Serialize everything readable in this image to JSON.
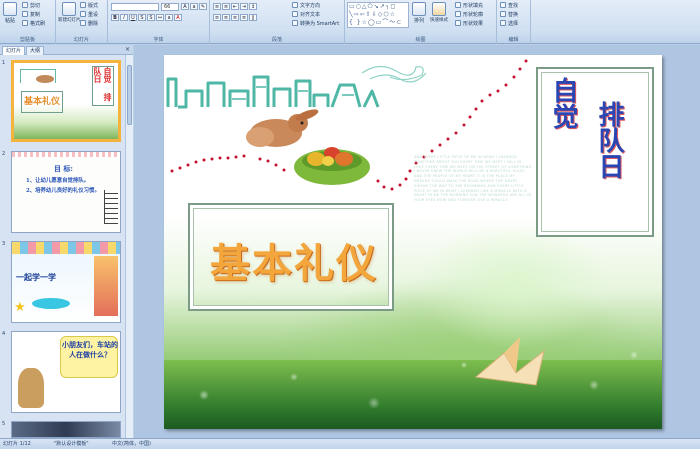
{
  "ribbon": {
    "clipboard": {
      "paste": "粘贴",
      "cut": "剪切",
      "copy": "复制",
      "format_painter": "格式刷",
      "label": "剪贴板"
    },
    "slides": {
      "new_slide": "新建幻灯片",
      "layout": "版式",
      "reset": "重设",
      "delete": "删除",
      "label": "幻灯片"
    },
    "font": {
      "font_size": "66",
      "label": "字体"
    },
    "paragraph": {
      "text_direction": "文字方向",
      "align_text": "对齐文本",
      "smartart": "转换为 SmartArt",
      "label": "段落"
    },
    "drawing": {
      "arrange": "排列",
      "quick_styles": "快速样式",
      "shape_fill": "形状填充",
      "shape_outline": "形状轮廓",
      "shape_effects": "形状效果",
      "label": "绘图"
    },
    "editing": {
      "find": "查找",
      "replace": "替换",
      "select": "选择",
      "label": "编辑"
    }
  },
  "panel": {
    "tab_slides": "幻灯片",
    "tab_outline": "大纲",
    "thumbs": [
      {
        "num": "1",
        "title": "基本礼仪",
        "side": "自觉 排队日"
      },
      {
        "num": "2",
        "head": "目 标:",
        "line1": "1、让幼儿愿意自觉排队。",
        "line2": "2、培养幼儿良好的礼仪习惯。"
      },
      {
        "num": "3",
        "text": "一起学一学"
      },
      {
        "num": "4",
        "text": "小朋友们，车站的人在做什么？"
      },
      {
        "num": "5"
      }
    ]
  },
  "slide": {
    "title": "基本礼仪",
    "vertical_1": "自觉",
    "vertical_2": "排队日",
    "english_text": "AND EVERY LITTLE PIECE OF ME IN WHAT I LEARNED TOGETHER ABOUT YOU EVERY TIME WE MEET I FALL IN LOVE EVERY TIME WE MEET ON THE STREET OF SOMETHING I NEVER KNEW THE WORLD WILL BE A BEAUTIFUL PLACE AND THE PEOPLE OF MY HEART IT IS THE PLACE MY DREAMS COULD WALK THE ROAD WHERE THE HEART SHOWS THE WAY TO THE BEGINNING AND EVERY LITTLE PIECE OF ME IN WHAT I LEARNED LIKE A MIRACLE WITH A HEART IN ME THE MORNING SUN THE WONDERS ARE ALL IN YOUR EYES NOW AND FOREVER LIKE A MIRACLE"
  },
  "status": {
    "slide_info": "幻灯片 1/12",
    "theme": "\"默认设计模板\"",
    "language": "中文(简体，中国)"
  }
}
